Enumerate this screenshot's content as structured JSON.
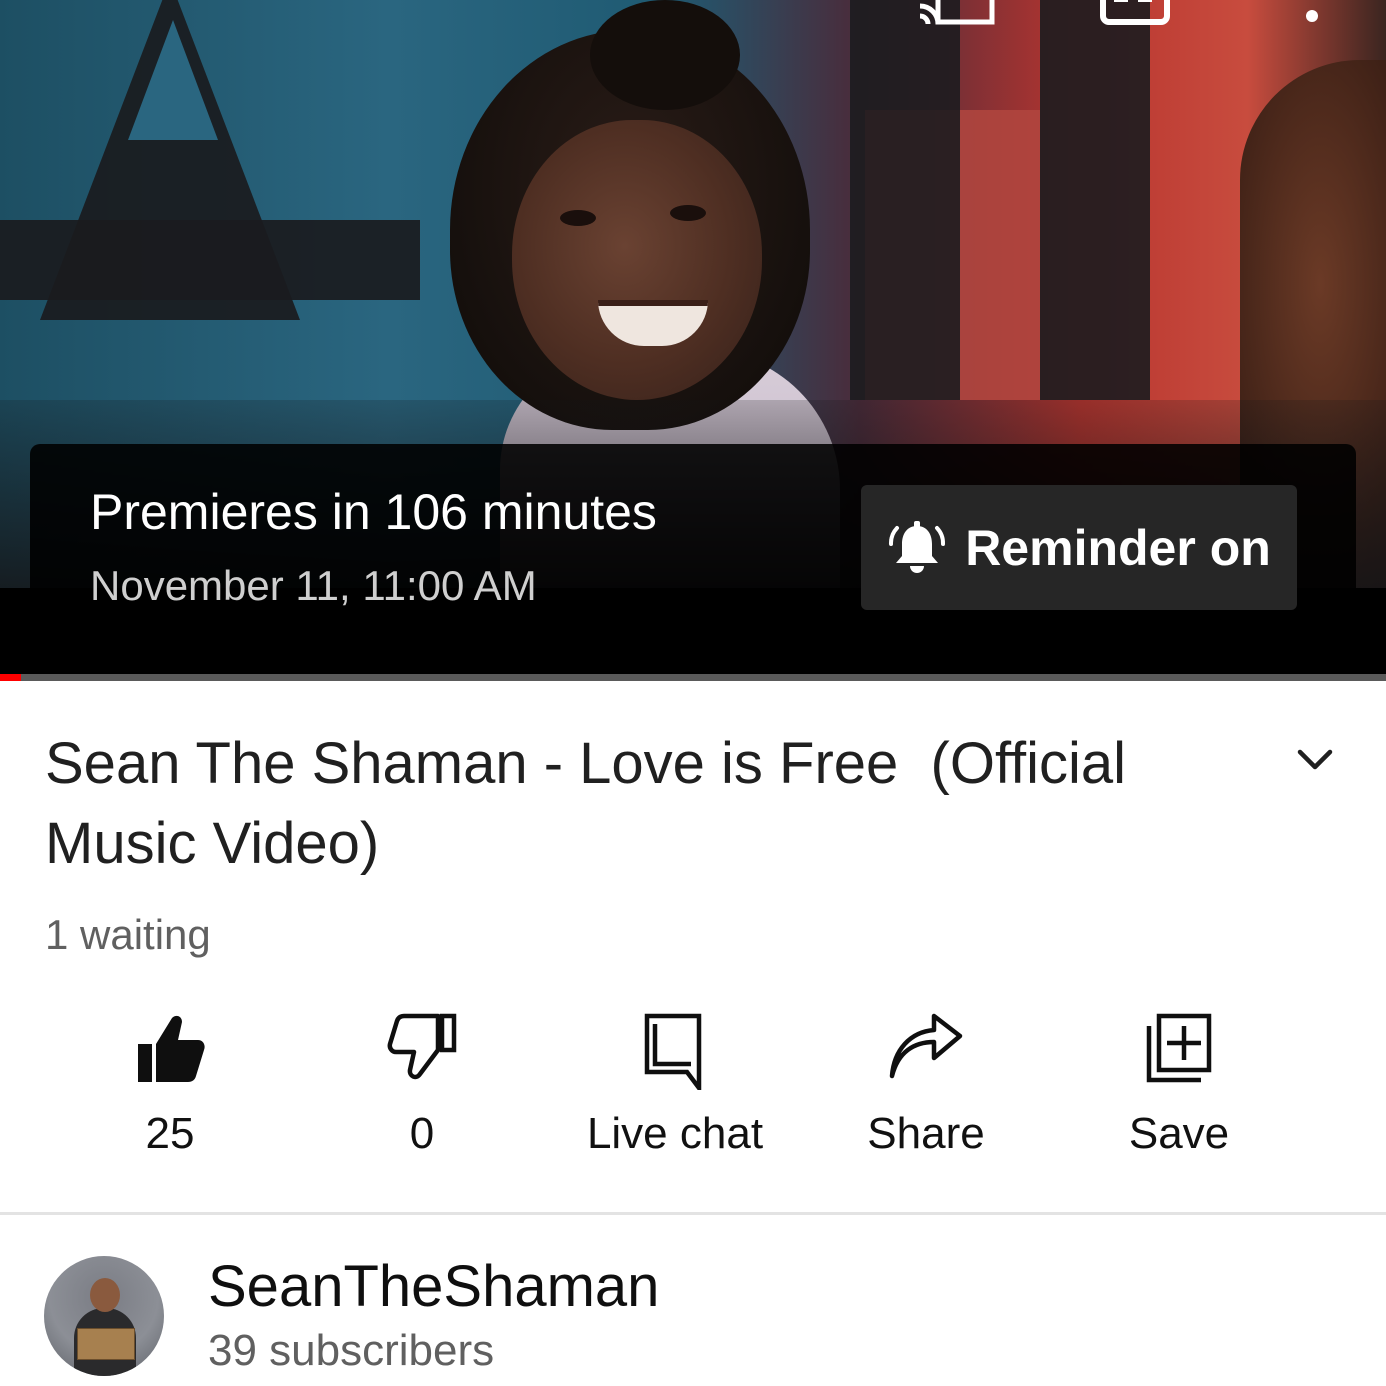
{
  "player": {
    "premiere_text": "Premieres in 106 minutes",
    "premiere_date": "November 11, 11:00 AM",
    "reminder_label": "Reminder on",
    "progress_fraction": 0.015,
    "accent_color": "#ff0000",
    "icons": [
      "cast-icon",
      "captions-icon",
      "more-options-icon",
      "bell-ringing-icon"
    ]
  },
  "video": {
    "title": "Sean The Shaman - Love is Free  (Official\nMusic Video)",
    "waiting": "1 waiting"
  },
  "actions": {
    "like_count": "25",
    "dislike_count": "0",
    "live_chat_label": "Live chat",
    "share_label": "Share",
    "save_label": "Save",
    "icons": [
      "thumbs-up-icon",
      "thumbs-down-icon",
      "chat-icon",
      "share-icon",
      "save-playlist-icon"
    ]
  },
  "channel": {
    "name": "SeanTheShaman",
    "subscribers": "39 subscribers"
  }
}
